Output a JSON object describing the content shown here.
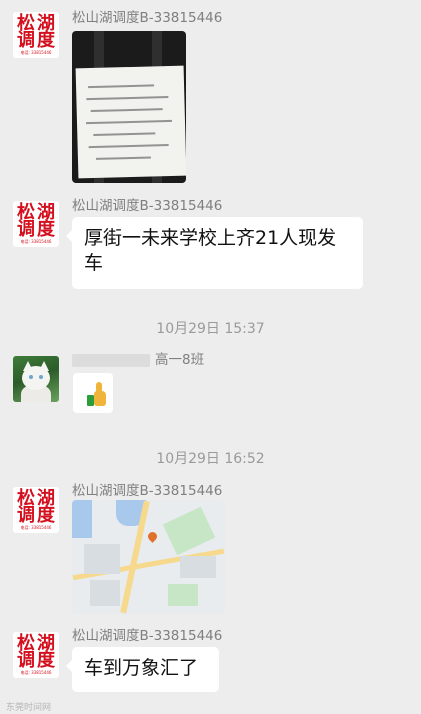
{
  "chat": {
    "messages": [
      {
        "id": 1,
        "sender": "松山湖调度B-33815446",
        "type": "image"
      },
      {
        "id": 2,
        "sender": "松山湖调度B-33815446",
        "type": "text",
        "text_line1": "厚街一未来学校上齐21人现发",
        "text_line2": "车"
      },
      {
        "id": 3,
        "sender_blurred": true,
        "sender_suffix": "高一8班",
        "type": "emoji"
      },
      {
        "id": 4,
        "sender": "松山湖调度B-33815446",
        "type": "map"
      },
      {
        "id": 5,
        "sender": "松山湖调度B-33815446",
        "type": "text",
        "text": "车到万象汇了"
      }
    ],
    "timestamps": [
      "10月29日 15:37",
      "10月29日 16:52"
    ]
  },
  "avatar_seal": {
    "chars": [
      "松",
      "湖",
      "调",
      "度"
    ],
    "small_text": "电话: 33815446"
  },
  "watermark": "东莞时间网",
  "colors": {
    "background": "#ededed",
    "bubble": "#ffffff",
    "seal_red": "#d4101f",
    "meta_text": "#9a9a9a"
  },
  "icons": [
    "thumbs-up-emoji",
    "map-pin-icon"
  ]
}
